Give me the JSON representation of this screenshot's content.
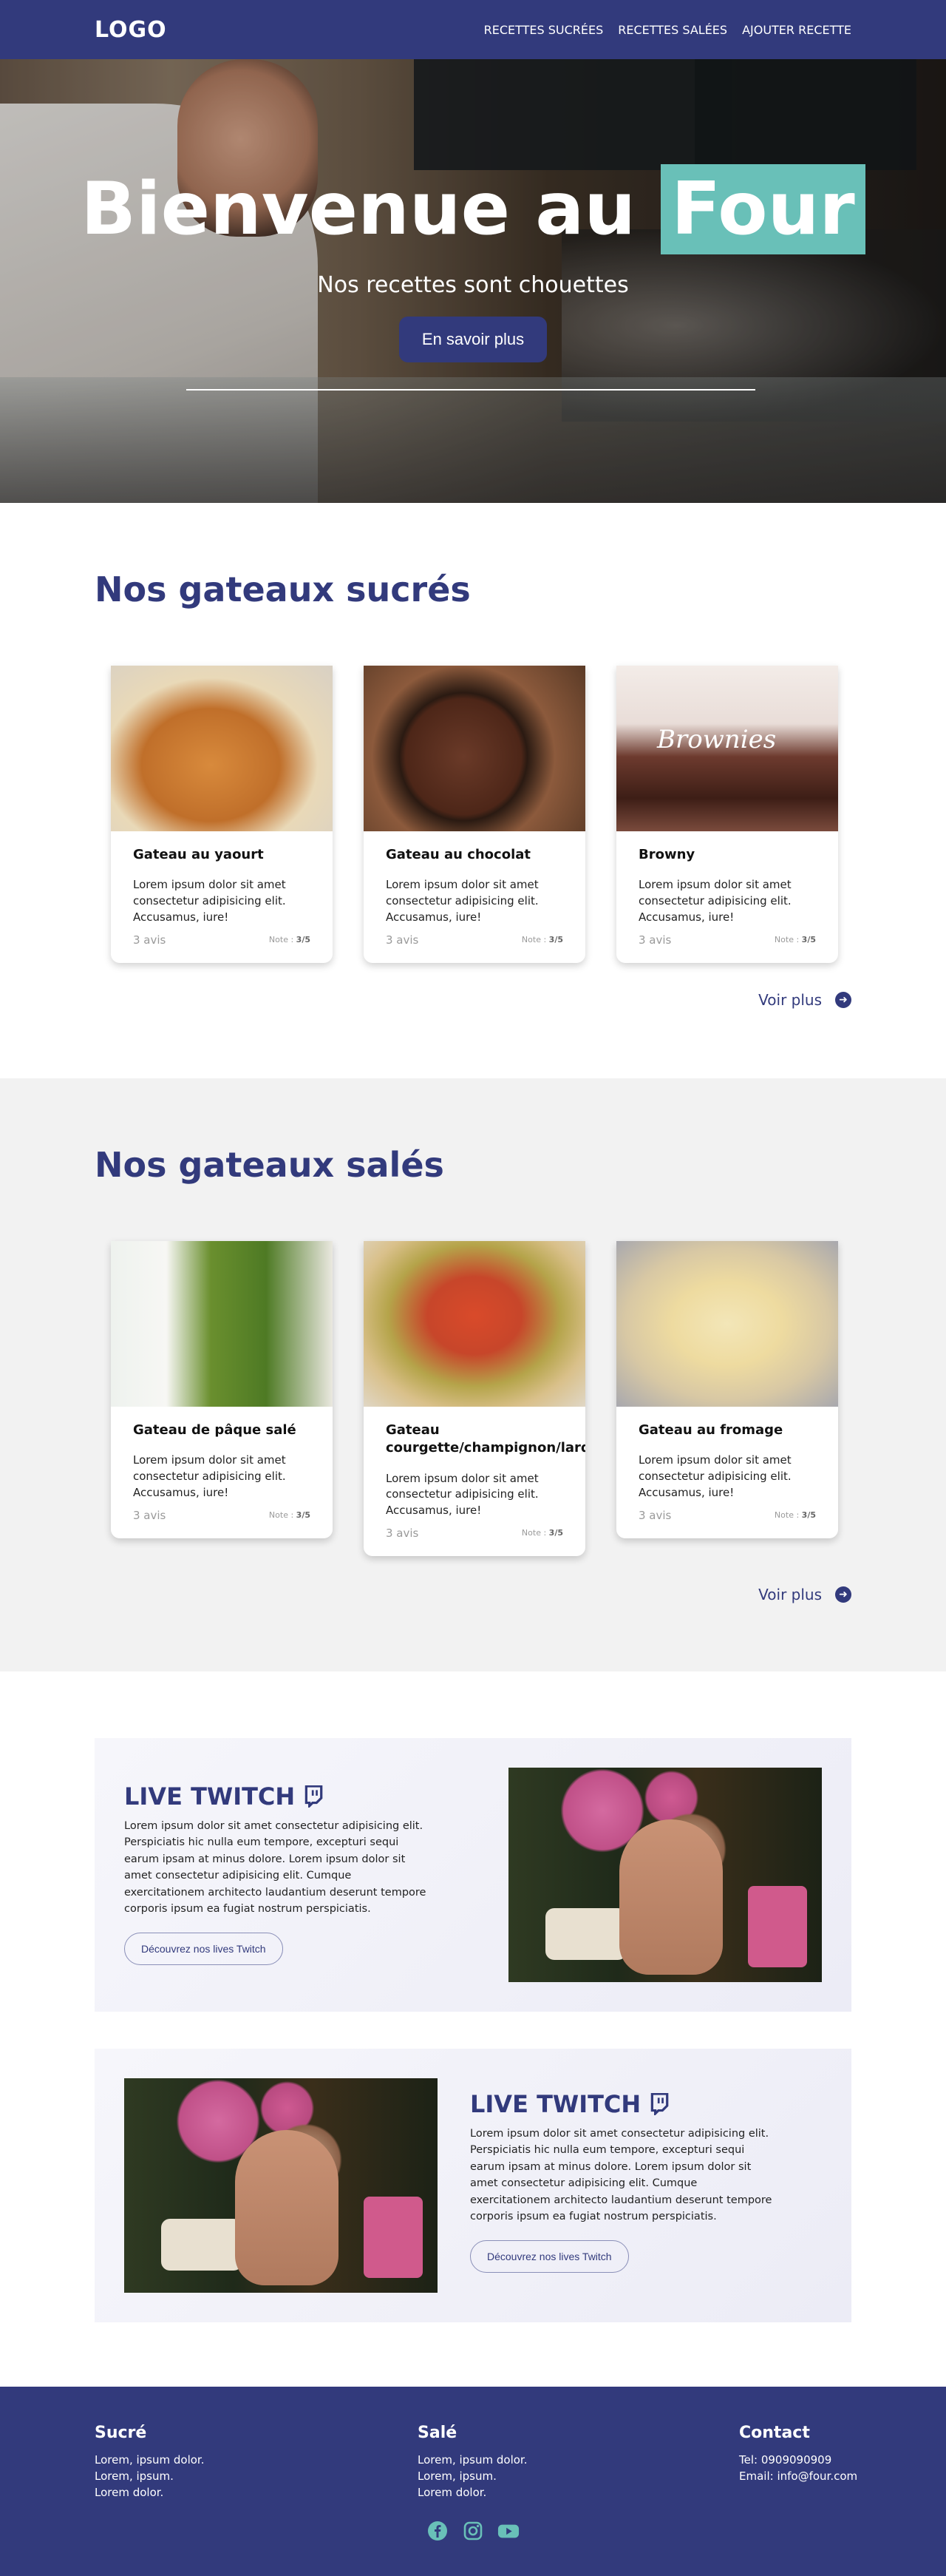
{
  "nav": {
    "logo": "LOGO",
    "links": [
      "RECETTES SUCRÉES",
      "RECETTES SALÉES",
      "AJOUTER RECETTE"
    ]
  },
  "hero": {
    "title_start": "Bienvenue au ",
    "title_highlight": "Four",
    "subtitle": "Nos recettes sont chouettes",
    "button": "En savoir plus",
    "highlight_color": "#69c0b8"
  },
  "sweet": {
    "title": "Nos gateaux sucrés",
    "cards": [
      {
        "title": "Gateau au yaourt",
        "text": "Lorem ipsum dolor sit amet consectetur adipisicing elit. Accusamus, iure!",
        "avis": "3 avis",
        "note_label": "Note :",
        "note_value": "3/5"
      },
      {
        "title": "Gateau au chocolat",
        "text": "Lorem ipsum dolor sit amet consectetur adipisicing elit. Accusamus, iure!",
        "avis": "3 avis",
        "note_label": "Note :",
        "note_value": "3/5"
      },
      {
        "title": "Browny",
        "text": "Lorem ipsum dolor sit amet consectetur adipisicing elit. Accusamus, iure!",
        "avis": "3 avis",
        "note_label": "Note :",
        "note_value": "3/5",
        "image_text": "Brownies"
      }
    ],
    "voir_plus": "Voir plus"
  },
  "salty": {
    "title": "Nos gateaux salés",
    "cards": [
      {
        "title": "Gateau de pâque salé",
        "text": "Lorem ipsum dolor sit amet consectetur adipisicing elit. Accusamus, iure!",
        "avis": "3 avis",
        "note_label": "Note :",
        "note_value": "3/5"
      },
      {
        "title": "Gateau courgette/champignon/lardon",
        "text": "Lorem ipsum dolor sit amet consectetur adipisicing elit. Accusamus, iure!",
        "avis": "3 avis",
        "note_label": "Note :",
        "note_value": "3/5"
      },
      {
        "title": "Gateau au fromage",
        "text": "Lorem ipsum dolor sit amet consectetur adipisicing elit. Accusamus, iure!",
        "avis": "3 avis",
        "note_label": "Note :",
        "note_value": "3/5"
      }
    ],
    "voir_plus": "Voir plus"
  },
  "twitch": [
    {
      "title": "LIVE TWITCH",
      "text": "Lorem ipsum dolor sit amet consectetur adipisicing elit. Perspiciatis hic nulla eum tempore, excepturi sequi earum ipsam at minus dolore. Lorem ipsum dolor sit amet consectetur adipisicing elit. Cumque exercitationem architecto laudantium deserunt tempore corporis ipsum ea fugiat nostrum perspiciatis.",
      "button": "Découvrez nos lives Twitch"
    },
    {
      "title": "LIVE TWITCH",
      "text": "Lorem ipsum dolor sit amet consectetur adipisicing elit. Perspiciatis hic nulla eum tempore, excepturi sequi earum ipsam at minus dolore. Lorem ipsum dolor sit amet consectetur adipisicing elit. Cumque exercitationem architecto laudantium deserunt tempore corporis ipsum ea fugiat nostrum perspiciatis.",
      "button": "Découvrez nos lives Twitch"
    }
  ],
  "footer": {
    "sucre": {
      "title": "Sucré",
      "lines": [
        "Lorem, ipsum dolor.",
        "Lorem, ipsum.",
        "Lorem dolor."
      ]
    },
    "sale": {
      "title": "Salé",
      "lines": [
        "Lorem, ipsum dolor.",
        "Lorem, ipsum.",
        "Lorem dolor."
      ]
    },
    "contact": {
      "title": "Contact",
      "lines": [
        "Tel: 0909090909",
        "Email: info@four.com"
      ]
    },
    "socials": [
      "facebook-icon",
      "instagram-icon",
      "youtube-icon"
    ]
  },
  "colors": {
    "primary": "#323a7c",
    "accent": "#69c0b8",
    "grey_bg": "#f2f2f2"
  }
}
